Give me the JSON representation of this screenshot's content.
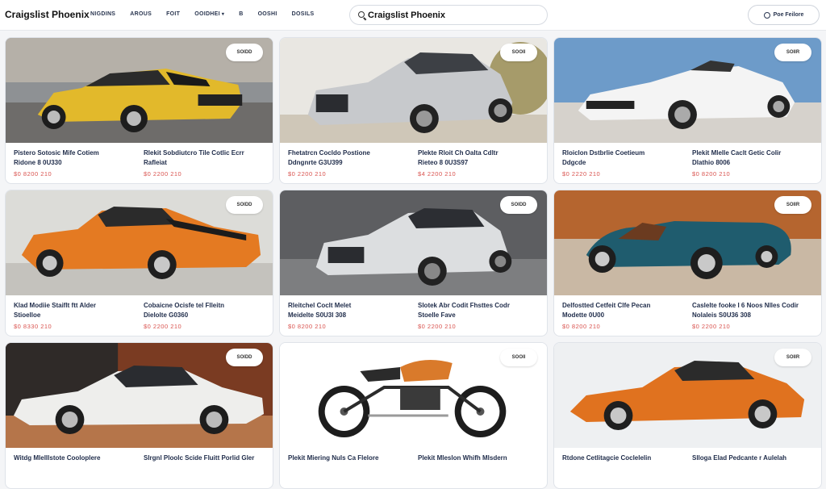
{
  "header": {
    "brand": "Craigslist Phoenix",
    "nav": [
      {
        "label": "NIGDINS",
        "dropdown": false
      },
      {
        "label": "AROUS",
        "dropdown": false
      },
      {
        "label": "FOIT",
        "dropdown": false
      },
      {
        "label": "OOIDHEI",
        "dropdown": true
      },
      {
        "label": "B",
        "dropdown": false
      },
      {
        "label": "OOSHI",
        "dropdown": false
      },
      {
        "label": "DOSILS",
        "dropdown": false
      }
    ],
    "search_value": "Craigslist Phoenix",
    "post_button": "Poe Feilore"
  },
  "listings": [
    {
      "badge": "SOIDD",
      "photo": "yellow-muscle-car",
      "left": {
        "t1": "Pistero Sotosic Mife Cotiem",
        "t2": "Ridone 8 0U330",
        "price": "$0 8200 210"
      },
      "right": {
        "t1": "Rlekit Sobdiutcro Tile Cotlic Ecrr",
        "t2": "Rafleiat",
        "price": "$0 2200 210"
      }
    },
    {
      "badge": "SOOII",
      "photo": "silver-sedan",
      "left": {
        "t1": "Fhetatrcn Cocldo Postione",
        "t2": "Ddngnrte G3U399",
        "price": "$0 2200 210"
      },
      "right": {
        "t1": "Plekte Rloit Ch Oalta Cdltr",
        "t2": "Rieteo 8 0U3S97",
        "price": "$4 2200 210"
      }
    },
    {
      "badge": "SOIIR",
      "photo": "white-convertible",
      "left": {
        "t1": "Rloiclon Dstbrlie Coetieum",
        "t2": "Ddgcde",
        "price": "$0 2220 210"
      },
      "right": {
        "t1": "Plekit Mlelle Caclt Getic Colir",
        "t2": "Dlathio 8006",
        "price": "$0 8200 210"
      }
    },
    {
      "badge": "SOIDD",
      "photo": "orange-muscle-car",
      "left": {
        "t1": "Klad Modiie Staiflt ftt Alder",
        "t2": "Stioelloe",
        "price": "$0 8330 210"
      },
      "right": {
        "t1": "Cobaicne Ocisfe tel Flleitn",
        "t2": "Dielolte G0360",
        "price": "$0 2200 210"
      }
    },
    {
      "badge": "SOIDD",
      "photo": "silver-coupe",
      "left": {
        "t1": "Rleitchel Coclt Melet",
        "t2": "Meidelte S0U3I 308",
        "price": "$0 8200 210"
      },
      "right": {
        "t1": "Slotek Abr Codit Fhsttes Codr",
        "t2": "Stoelle Fave",
        "price": "$0 2200 210"
      }
    },
    {
      "badge": "SOIIR",
      "photo": "teal-roadster",
      "left": {
        "t1": "Delfostted Cetfeit Clfe Pecan",
        "t2": "Modette 0U00",
        "price": "$0 8200 210"
      },
      "right": {
        "t1": "Caslelte fooke I 6 Noos Nlles Codir",
        "t2": "Nolaleis S0U36 308",
        "price": "$0 2200 210"
      }
    },
    {
      "badge": "SOIDD",
      "photo": "white-classic-coupe",
      "left": {
        "t1": "Witdg Mlelllstote Cooloplere",
        "t2": "",
        "price": ""
      },
      "right": {
        "t1": "Slrgnl Ploolc Scide Fluitt Porlid Gler",
        "t2": "",
        "price": ""
      }
    },
    {
      "badge": "SOOII",
      "photo": "orange-cafe-racer",
      "left": {
        "t1": "Plekit Miering Nuls Ca Flelore",
        "t2": "",
        "price": ""
      },
      "right": {
        "t1": "Plekit Mleslon Whifh Mlsdern",
        "t2": "",
        "price": ""
      }
    },
    {
      "badge": "SOIIR",
      "photo": "orange-sports-car",
      "left": {
        "t1": "Rtdone Cetlitagcie Coclelelin",
        "t2": "",
        "price": ""
      },
      "right": {
        "t1": "Slloga Elad Pedcante r Aulelah",
        "t2": "",
        "price": ""
      }
    }
  ]
}
